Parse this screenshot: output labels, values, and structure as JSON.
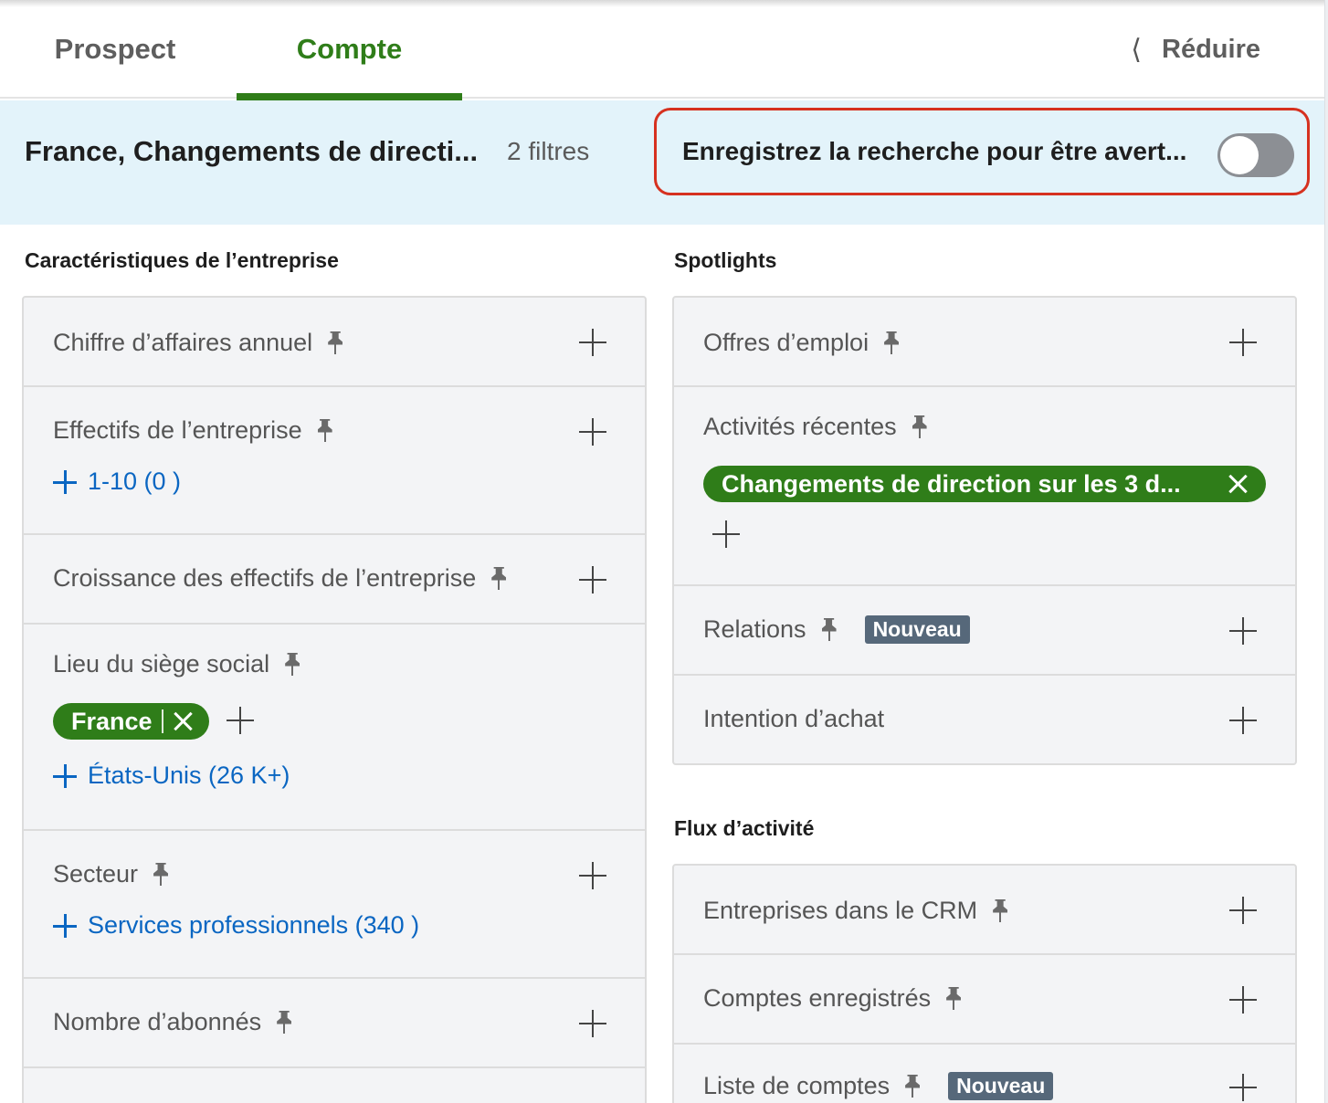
{
  "tabs": {
    "prospect": "Prospect",
    "compte": "Compte",
    "reduce": "Réduire"
  },
  "banner": {
    "title": "France, Changements de directi...",
    "count": "2 filtres",
    "save_text": "Enregistrez la recherche pour être avert...",
    "toggle_on": false
  },
  "left": {
    "heading": "Caractéristiques de l’entreprise",
    "rows": {
      "revenue": "Chiffre d’affaires annuel",
      "headcount": "Effectifs de l’entreprise",
      "headcount_suggest": "1-10 (0 )",
      "growth": "Croissance des effectifs de l’entreprise",
      "hq": "Lieu du siège social",
      "hq_chip": "France",
      "hq_suggest": "États-Unis (26 K+)",
      "sector": "Secteur",
      "sector_suggest": "Services professionnels (340 )",
      "followers": "Nombre d’abonnés"
    }
  },
  "spotlights": {
    "heading": "Spotlights",
    "rows": {
      "jobs": "Offres d’emploi",
      "recent": "Activités récentes",
      "recent_chip": "Changements de direction sur les 3 d...",
      "relations": "Relations",
      "relations_badge": "Nouveau",
      "intent": "Intention d’achat"
    }
  },
  "flux": {
    "heading": "Flux d’activité",
    "rows": {
      "crm": "Entreprises dans le CRM",
      "saved": "Comptes enregistrés",
      "lists": "Liste de comptes",
      "lists_badge": "Nouveau"
    }
  },
  "colors": {
    "accent_green": "#2f7d19",
    "link_blue": "#0a66c2",
    "banner_bg": "#e3f3fa",
    "highlight_red": "#d6311f"
  }
}
